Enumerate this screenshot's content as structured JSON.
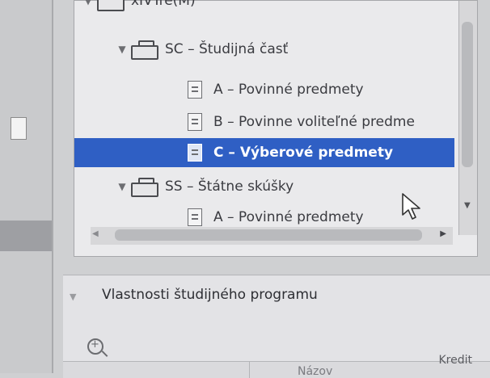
{
  "tree": {
    "items": [
      {
        "kind": "folder",
        "expanded": true,
        "label": "xIVTre(M)"
      },
      {
        "kind": "folder",
        "expanded": true,
        "label": "SC – Študijná časť"
      },
      {
        "kind": "document",
        "label": "A – Povinné predmety"
      },
      {
        "kind": "document",
        "label": "B – Povinne voliteľné predme"
      },
      {
        "kind": "document",
        "label": "C – Výberové predmety",
        "selected": true
      },
      {
        "kind": "folder",
        "expanded": true,
        "label": "SS – Štátne skúšky"
      },
      {
        "kind": "document",
        "label": "A – Povinné predmety"
      }
    ],
    "expand_glyph": "▼"
  },
  "properties": {
    "title": "Vlastnosti študijného programu",
    "zoom_glyph": "+",
    "columns": [
      "Názov",
      "Kredit"
    ]
  },
  "scroll": {
    "up_glyph": "▲",
    "down_glyph": "▼",
    "left_glyph": "◀",
    "right_glyph": "▶"
  },
  "colors": {
    "selection": "#2f5fc4",
    "panel": "#eaeaec"
  }
}
